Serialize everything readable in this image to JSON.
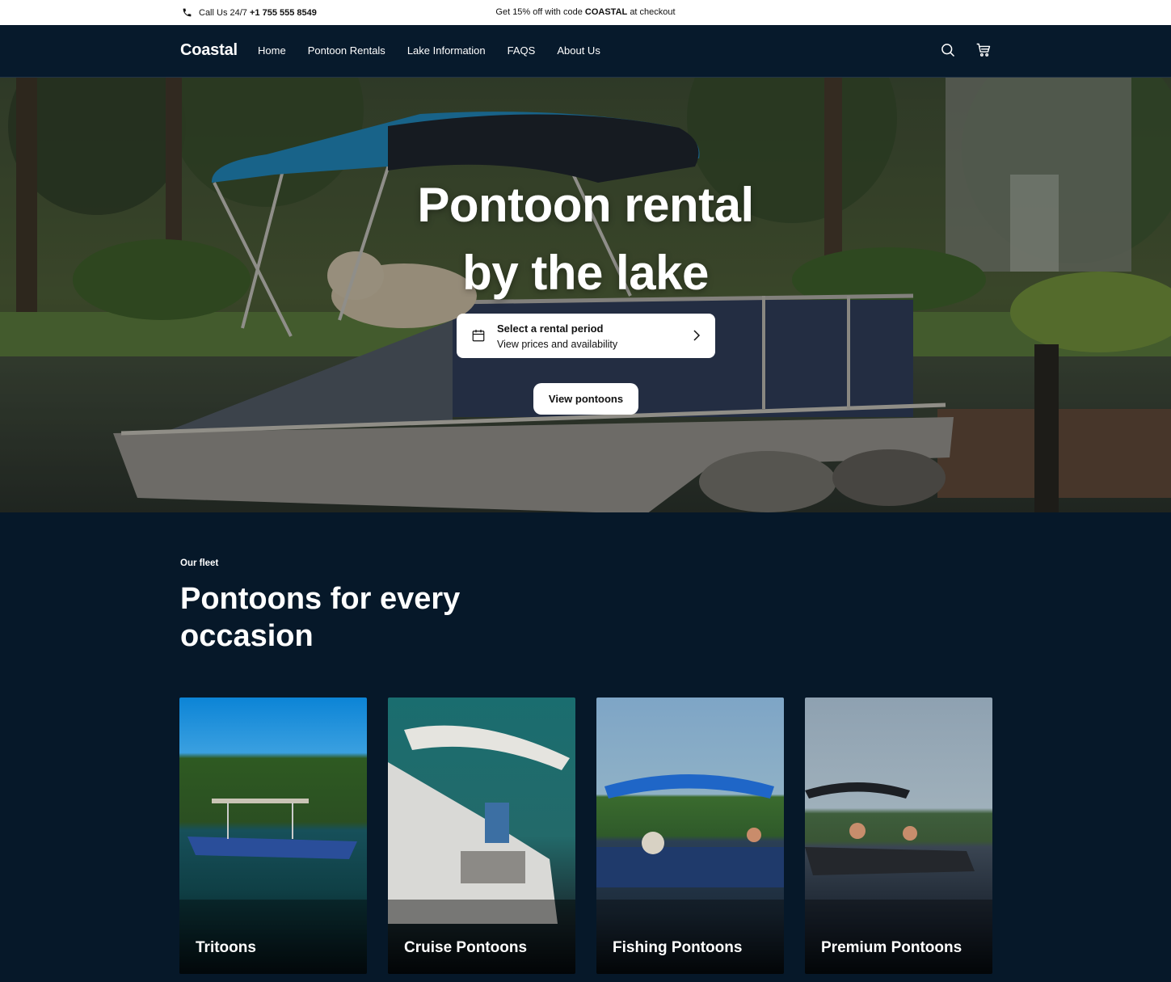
{
  "announcement": {
    "call_prefix": "Call Us 24/7",
    "phone": "+1 755 555 8549",
    "promo_pre": "Get 15% off with code",
    "promo_code": "COASTAL",
    "promo_post": "at checkout"
  },
  "nav": {
    "logo": "Coastal",
    "items": [
      "Home",
      "Pontoon Rentals",
      "Lake Information",
      "FAQS",
      "About Us"
    ]
  },
  "hero": {
    "title_line1": "Pontoon rental",
    "title_line2": "by the lake",
    "picker_title": "Select a rental period",
    "picker_subtitle": "View prices and availability",
    "button": "View pontoons"
  },
  "fleet": {
    "eyebrow": "Our fleet",
    "title": "Pontoons for every occasion",
    "cards": [
      {
        "label": "Tritoons"
      },
      {
        "label": "Cruise Pontoons"
      },
      {
        "label": "Fishing Pontoons"
      },
      {
        "label": "Premium Pontoons"
      }
    ]
  },
  "colors": {
    "page_bg": "#061829",
    "nav_bg": "#071a2c",
    "bimini_accent": "#1f7fb0"
  }
}
